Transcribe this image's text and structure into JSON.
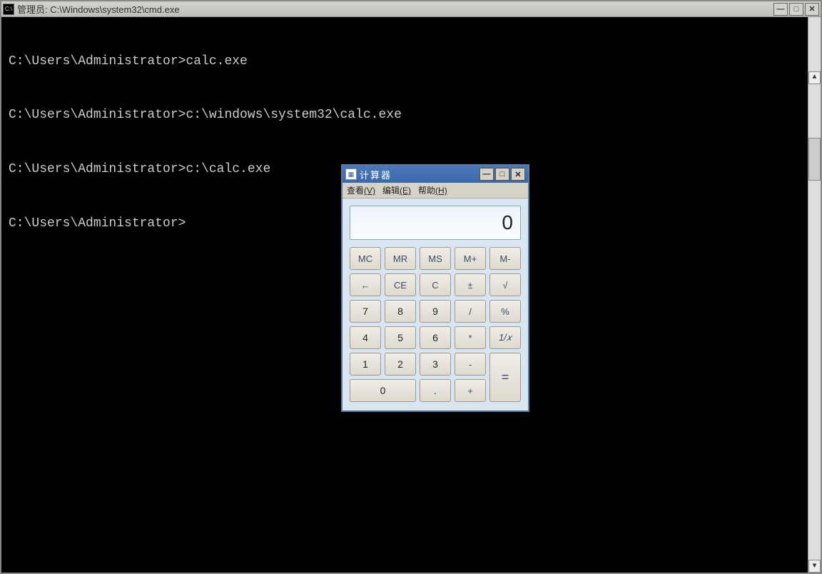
{
  "cmd": {
    "title": "管理员: C:\\Windows\\system32\\cmd.exe",
    "icon_label": "C:\\",
    "lines": [
      "",
      "C:\\Users\\Administrator>calc.exe",
      "",
      "C:\\Users\\Administrator>c:\\windows\\system32\\calc.exe",
      "",
      "C:\\Users\\Administrator>c:\\calc.exe",
      "",
      "C:\\Users\\Administrator>"
    ],
    "buttons": {
      "minimize": "—",
      "maximize": "□",
      "close": "✕"
    },
    "scroll": {
      "up": "▲",
      "down": "▼"
    }
  },
  "calc": {
    "title": "计算器",
    "buttons": {
      "minimize": "—",
      "maximize": "□",
      "close": "✕"
    },
    "menu": {
      "view": "查看",
      "view_key": "(V)",
      "edit": "编辑",
      "edit_key": "(E)",
      "help": "帮助",
      "help_key": "(H)"
    },
    "display": "0",
    "keys": {
      "mc": "MC",
      "mr": "MR",
      "ms": "MS",
      "mplus": "M+",
      "mminus": "M-",
      "back": "←",
      "ce": "CE",
      "c": "C",
      "pm": "±",
      "sqrt": "√",
      "n7": "7",
      "n8": "8",
      "n9": "9",
      "div": "/",
      "pct": "%",
      "n4": "4",
      "n5": "5",
      "n6": "6",
      "mul": "*",
      "recip": "1/𝑥",
      "n1": "1",
      "n2": "2",
      "n3": "3",
      "sub": "-",
      "eq": "=",
      "n0": "0",
      "dot": ".",
      "add": "+"
    }
  }
}
